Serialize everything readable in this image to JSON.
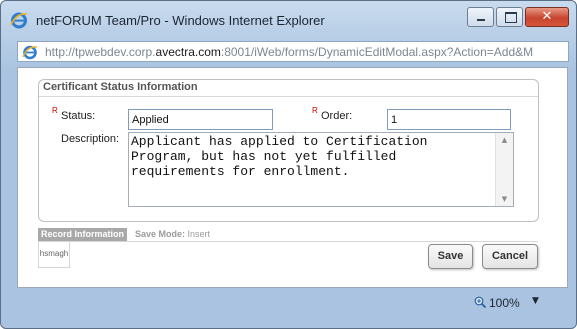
{
  "window": {
    "title": "netFORUM Team/Pro - Windows Internet Explorer",
    "minimize_glyph": "",
    "close_glyph": "✕"
  },
  "address": {
    "prefix": "http://tpwebdev.corp.",
    "domain": "avectra.com",
    "suffix": ":8001/iWeb/forms/DynamicEditModal.aspx?Action=Add&M"
  },
  "form": {
    "legend": "Certificant Status Information",
    "required_marker": "R",
    "status_label": "Status:",
    "status_value": "Applied",
    "order_label": "Order:",
    "order_value": "1",
    "description_label": "Description:",
    "description_value": "Applicant has applied to Certification Program, but has not yet fulfilled requirements for enrollment."
  },
  "record": {
    "tab_label": "Record Information",
    "save_mode_label": "Save Mode:",
    "save_mode_value": "Insert",
    "user": "hsmagh"
  },
  "buttons": {
    "save": "Save",
    "cancel": "Cancel"
  },
  "status": {
    "zoom": "100%",
    "zoom_caret": "▼"
  },
  "colors": {
    "frame": "#b6cde6",
    "required": "#cc0000",
    "close_button": "#c9442d"
  }
}
